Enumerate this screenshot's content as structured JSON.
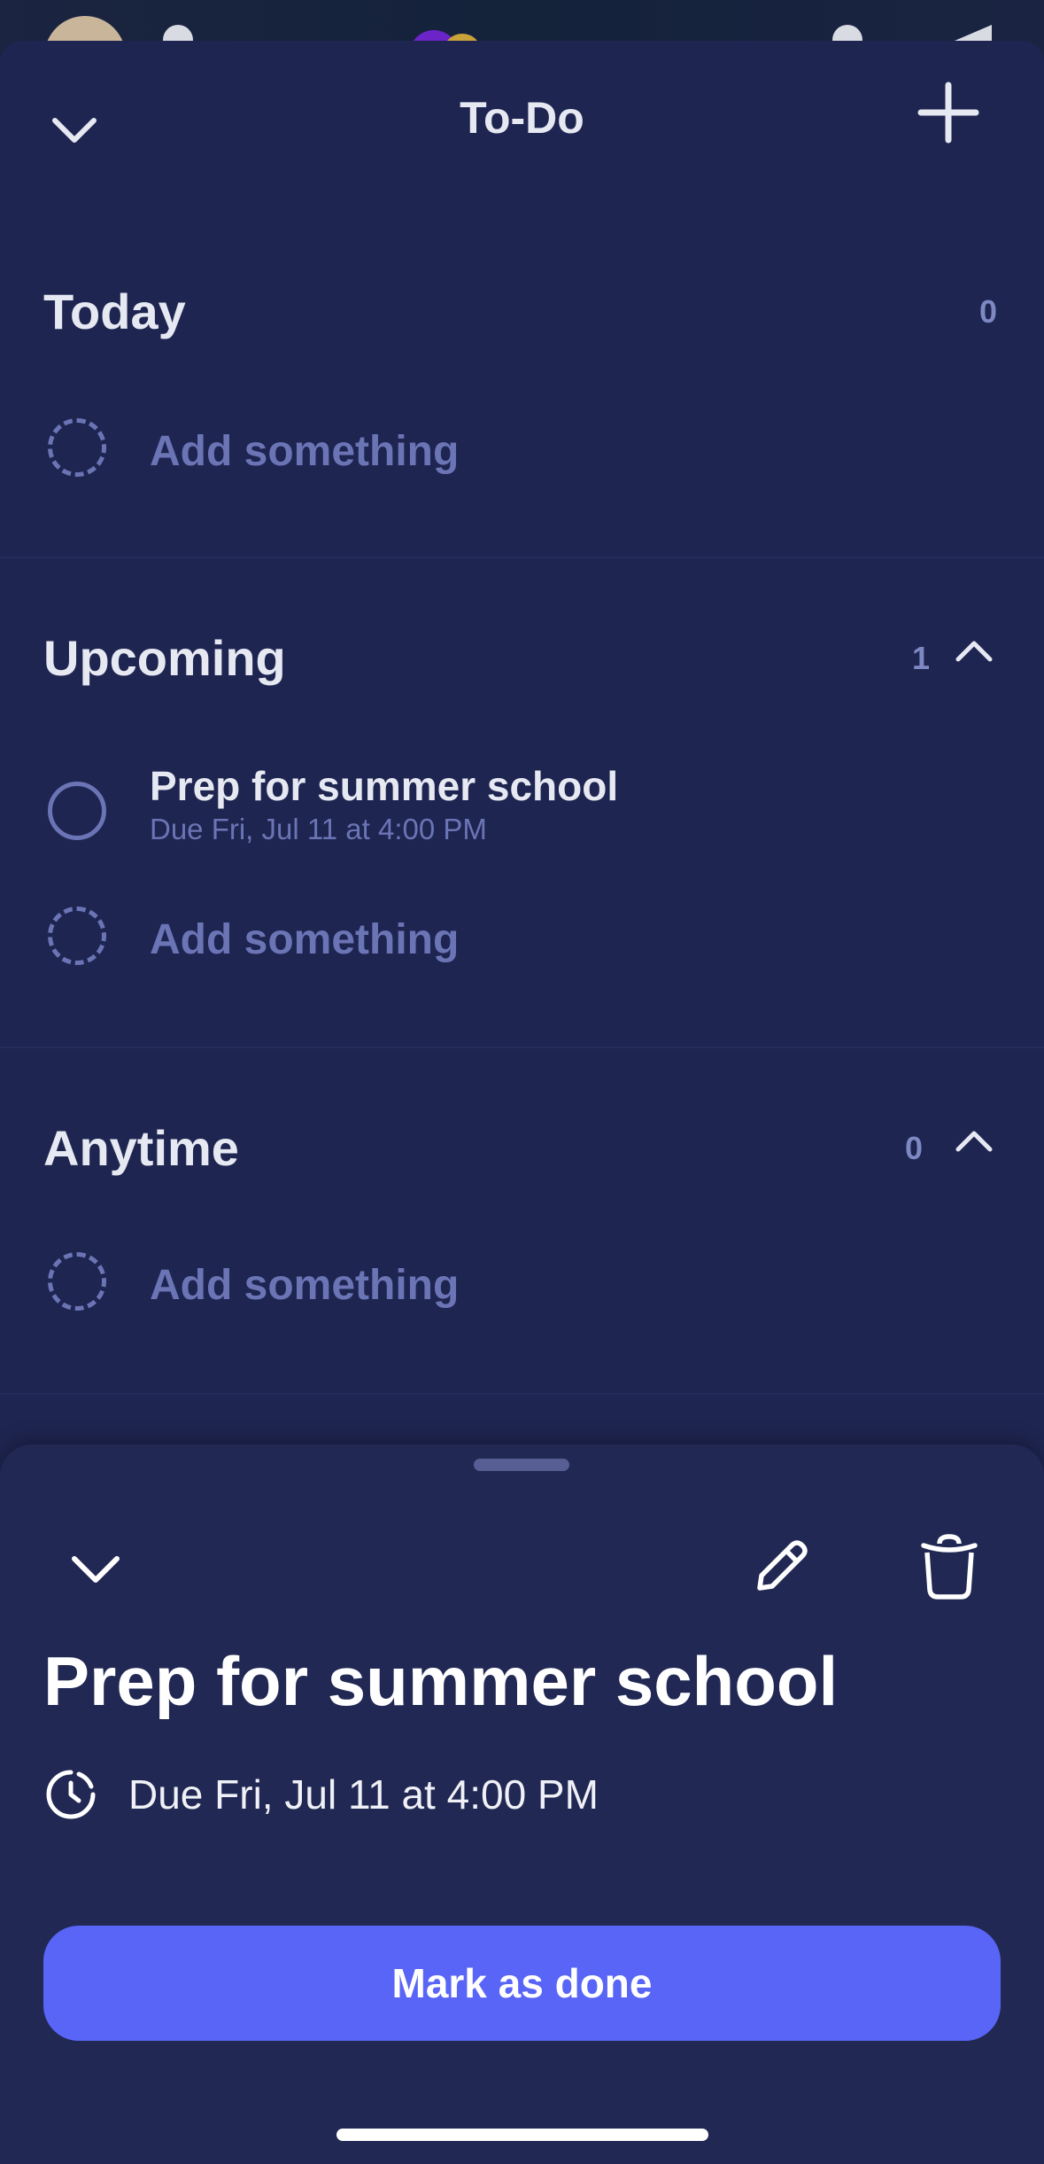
{
  "header": {
    "title": "To-Do",
    "collapse_icon": "chevron-down-icon",
    "add_icon": "plus-icon"
  },
  "sections": {
    "today": {
      "title": "Today",
      "count": "0",
      "add_label": "Add something"
    },
    "upcoming": {
      "title": "Upcoming",
      "count": "1",
      "tasks": [
        {
          "title": "Prep for summer school",
          "due": "Due Fri, Jul 11 at 4:00 PM"
        }
      ],
      "add_label": "Add something"
    },
    "anytime": {
      "title": "Anytime",
      "count": "0",
      "add_label": "Add something"
    }
  },
  "detail": {
    "title": "Prep for summer school",
    "due": "Due Fri, Jul 11 at 4:00 PM",
    "mark_done_label": "Mark as done",
    "icons": [
      "chevron-down-icon",
      "pencil-icon",
      "trash-icon",
      "clock-icon"
    ]
  },
  "colors": {
    "background": "#1e2550",
    "sheet": "#212853",
    "accent": "#5865f7",
    "muted": "#6b74b5",
    "text": "#e6e8f2"
  }
}
